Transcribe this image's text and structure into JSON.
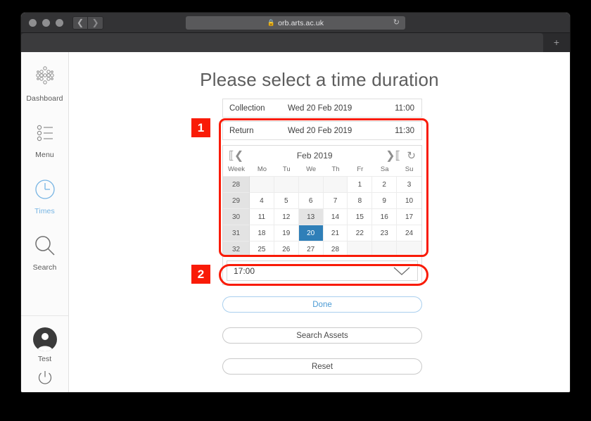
{
  "browser": {
    "url": "orb.arts.ac.uk",
    "lock_icon": "lock-icon",
    "reload_icon": "reload-icon",
    "back_icon": "chevron-left-icon",
    "forward_icon": "chevron-right-icon",
    "new_tab_icon": "plus-icon"
  },
  "sidebar": {
    "items": [
      {
        "label": "Dashboard",
        "icon": "dashboard-grid-icon",
        "active": false
      },
      {
        "label": "Menu",
        "icon": "list-icon",
        "active": false
      },
      {
        "label": "Times",
        "icon": "clock-icon",
        "active": true
      },
      {
        "label": "Search",
        "icon": "search-icon",
        "active": false
      }
    ],
    "user": {
      "label": "Test",
      "avatar_icon": "person-avatar-icon"
    },
    "power": {
      "icon": "power-icon"
    }
  },
  "main": {
    "title": "Please select a time duration",
    "booking_rows": [
      {
        "label": "Collection",
        "date": "Wed 20 Feb 2019",
        "time": "11:00"
      },
      {
        "label": "Return",
        "date": "Wed 20 Feb 2019",
        "time": "11:30"
      }
    ],
    "calendar": {
      "month_label": "Feb 2019",
      "prev_icon": "prev-month-icon",
      "next_icon": "next-month-icon",
      "refresh_icon": "refresh-icon",
      "day_headers": [
        "Week",
        "Mo",
        "Tu",
        "We",
        "Th",
        "Fr",
        "Sa",
        "Su"
      ],
      "rows": [
        {
          "week": "28",
          "days": [
            "",
            "",
            "",
            "",
            "1",
            "2",
            "3"
          ]
        },
        {
          "week": "29",
          "days": [
            "4",
            "5",
            "6",
            "7",
            "8",
            "9",
            "10"
          ]
        },
        {
          "week": "30",
          "days": [
            "11",
            "12",
            "13",
            "14",
            "15",
            "16",
            "17"
          ]
        },
        {
          "week": "31",
          "days": [
            "18",
            "19",
            "20",
            "21",
            "22",
            "23",
            "24"
          ]
        },
        {
          "week": "32",
          "days": [
            "25",
            "26",
            "27",
            "28",
            "",
            "",
            ""
          ]
        }
      ],
      "today": "13",
      "selected": "20",
      "selected_color": "#2f7fb8",
      "today_color": "#e4e4e4"
    },
    "time_select": {
      "value": "17:00",
      "chevron_icon": "chevron-down-icon"
    },
    "buttons": [
      {
        "label": "Done",
        "style": "primary"
      },
      {
        "label": "Search Assets",
        "style": "default"
      },
      {
        "label": "Reset",
        "style": "default"
      }
    ]
  },
  "annotations": {
    "accent_color": "#f91b07",
    "markers": [
      {
        "number": "1",
        "target": "calendar-panel"
      },
      {
        "number": "2",
        "target": "done-button"
      }
    ]
  }
}
